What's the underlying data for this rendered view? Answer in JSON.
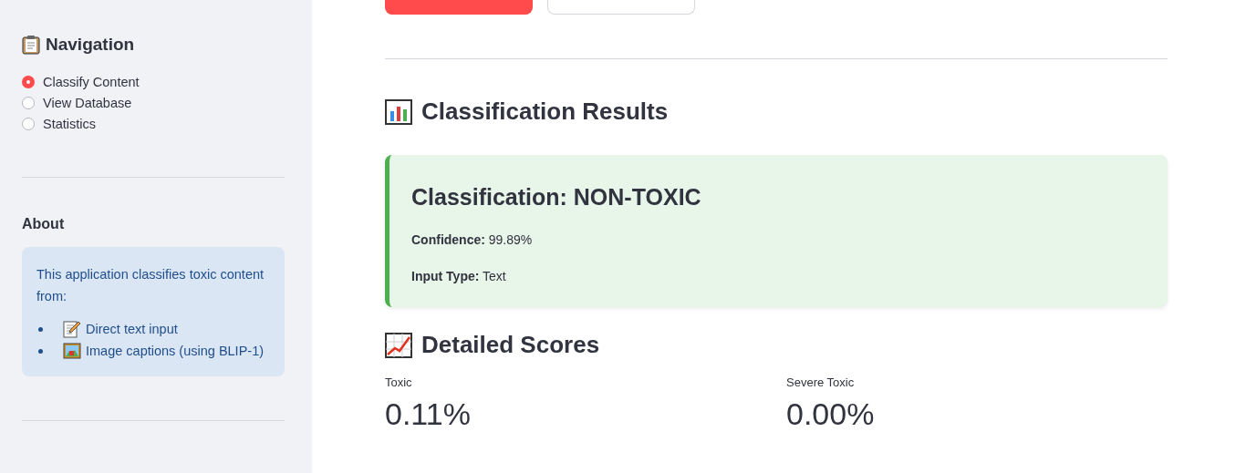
{
  "sidebar": {
    "navigation": {
      "title": "Navigation",
      "options": [
        {
          "label": "Classify Content",
          "selected": true
        },
        {
          "label": "View Database",
          "selected": false
        },
        {
          "label": "Statistics",
          "selected": false
        }
      ]
    },
    "about": {
      "title": "About",
      "text": "This application classifies toxic content from:",
      "items": [
        {
          "kind": "memo",
          "label": "Direct text input"
        },
        {
          "kind": "picture",
          "label": "Image captions (using BLIP-1)"
        }
      ]
    }
  },
  "main": {
    "buttons": [
      {
        "kind": "primary"
      },
      {
        "kind": "secondary"
      }
    ],
    "results": {
      "title": "Classification Results",
      "card": {
        "title": "Classification: NON-TOXIC",
        "fields": [
          {
            "label": "Confidence:",
            "value": "99.89%"
          },
          {
            "label": "Input Type:",
            "value": "Text"
          }
        ]
      }
    },
    "scores": {
      "title": "Detailed Scores",
      "metrics": [
        {
          "label": "Toxic",
          "value": "0.11%"
        },
        {
          "label": "Severe Toxic",
          "value": "0.00%"
        }
      ]
    }
  }
}
